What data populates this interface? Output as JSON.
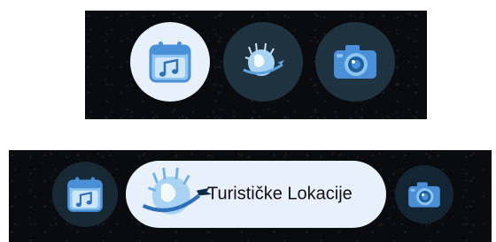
{
  "top_bar": {
    "buttons": [
      {
        "icon": "calendar-music-icon",
        "state": "active"
      },
      {
        "icon": "globe-travel-icon",
        "state": "inactive"
      },
      {
        "icon": "camera-icon",
        "state": "inactive"
      }
    ]
  },
  "bottom_bar": {
    "buttons": [
      {
        "icon": "calendar-music-icon",
        "state": "inactive"
      },
      {
        "icon": "globe-travel-icon",
        "state": "active",
        "label": "Turističke Lokacije"
      },
      {
        "icon": "camera-icon",
        "state": "inactive"
      }
    ]
  },
  "colors": {
    "background": "#0a0b0f",
    "active_bg": "#e8f1fb",
    "inactive_bg": "#1e3240",
    "icon_blue": "#4a90d9",
    "icon_light_blue": "#8ec5f0"
  }
}
